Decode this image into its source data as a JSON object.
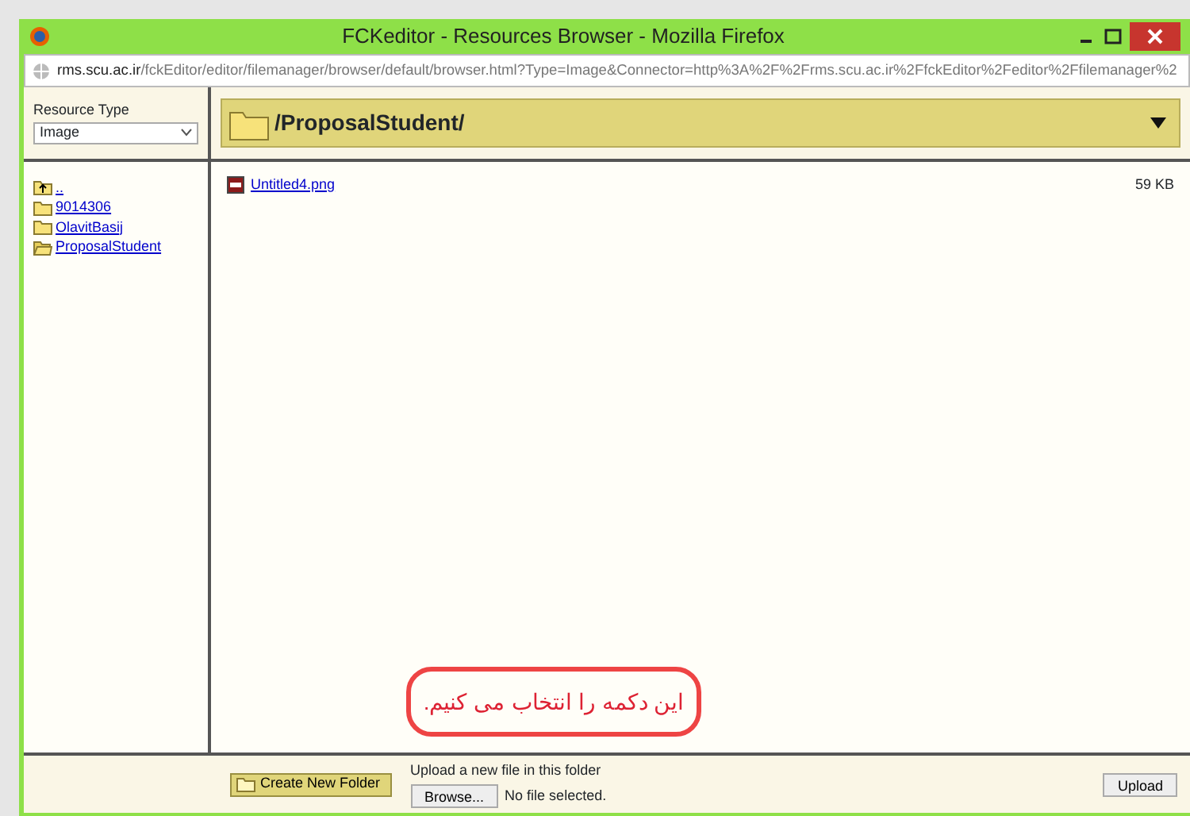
{
  "window": {
    "title": "FCKeditor - Resources Browser - Mozilla Firefox",
    "address": {
      "host": "rms.scu.ac.ir",
      "path": "/fckEditor/editor/filemanager/browser/default/browser.html?Type=Image&Connector=http%3A%2F%2Frms.scu.ac.ir%2FfckEditor%2Feditor%2Ffilemanager%2"
    }
  },
  "resource_type": {
    "label": "Resource Type",
    "value": "Image"
  },
  "folders": [
    {
      "name": "..",
      "kind": "up",
      "selected": false
    },
    {
      "name": "9014306",
      "kind": "folder",
      "selected": false
    },
    {
      "name": "OlavitBasij",
      "kind": "folder",
      "selected": false
    },
    {
      "name": "ProposalStudent",
      "kind": "folder",
      "selected": true
    }
  ],
  "current_path": "/ProposalStudent/",
  "files": [
    {
      "name": "Untitled4.png",
      "size": "59 KB"
    }
  ],
  "bottom_bar": {
    "create_folder": "Create New Folder",
    "upload_label": "Upload a new file in this folder",
    "browse": "Browse...",
    "file_status": "No file selected.",
    "upload": "Upload"
  },
  "annotation": {
    "text": "این دکمه را انتخاب می کنیم."
  }
}
